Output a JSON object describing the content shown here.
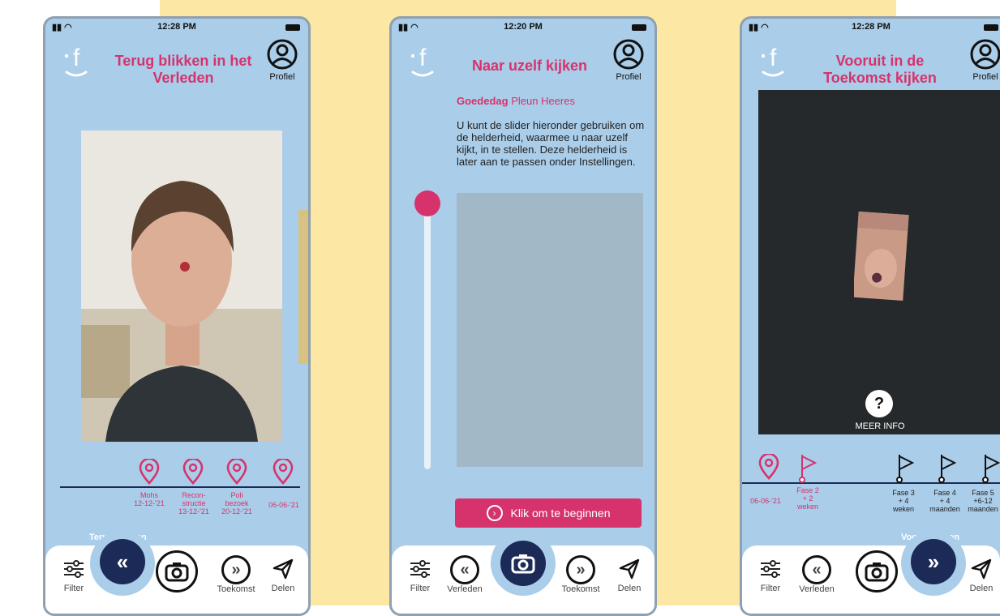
{
  "status": {
    "time_1": "12:28 PM",
    "time_2": "12:20 PM",
    "time_3": "12:28 PM"
  },
  "logo_letter": "f",
  "screens": {
    "past": {
      "title": "Terug blikken in het Verleden",
      "profile_label": "Profiel",
      "timeline": [
        {
          "line1": "Mohs",
          "line2": "12-12-'21",
          "line3": ""
        },
        {
          "line1": "Recon-",
          "line2": "structie",
          "line3": "13-12-'21"
        },
        {
          "line1": "Poli",
          "line2": "bezoek",
          "line3": "20-12-'21"
        },
        {
          "line1": "06-06-'21",
          "line2": "",
          "line3": ""
        }
      ],
      "section_label": "Terug blikken",
      "nav": {
        "filter": "Filter",
        "future": "Toekomst",
        "share": "Delen"
      }
    },
    "self": {
      "title": "Naar uzelf kijken",
      "profile_label": "Profiel",
      "greeting": "Goededag",
      "user_name": "Pleun Heeres",
      "instructions": "U kunt de slider hieronder gebruiken om de helderheid, waarmee u naar uzelf kijkt, in te stellen. Deze helderheid is later aan te passen onder Instellingen.",
      "brightness_level": 0.0,
      "start_button": "Klik om te beginnen",
      "nav": {
        "filter": "Filter",
        "past": "Verleden",
        "future": "Toekomst",
        "share": "Delen"
      }
    },
    "future": {
      "title": "Vooruit in de Toekomst kijken",
      "profile_label": "Profiel",
      "more_info": "MEER INFO",
      "more_info_icon": "?",
      "timeline": [
        {
          "line1": "06-06-'21",
          "line2": "",
          "line3": ""
        },
        {
          "line1": "Fase 2",
          "line2": "+ 2",
          "line3": "weken"
        },
        {
          "line1": "Fase 3",
          "line2": "+ 4",
          "line3": "weken"
        },
        {
          "line1": "Fase 4",
          "line2": "+ 4",
          "line3": "maanden"
        },
        {
          "line1": "Fase 5",
          "line2": "+6-12",
          "line3": "maanden"
        }
      ],
      "section_label": "Vooruit kijken",
      "nav": {
        "filter": "Filter",
        "past": "Verleden",
        "share": "Delen"
      }
    }
  },
  "colors": {
    "accent": "#d6336c",
    "phone_bg": "#aacde9",
    "nav_active": "#1b2a57",
    "band": "#fce7a4"
  }
}
